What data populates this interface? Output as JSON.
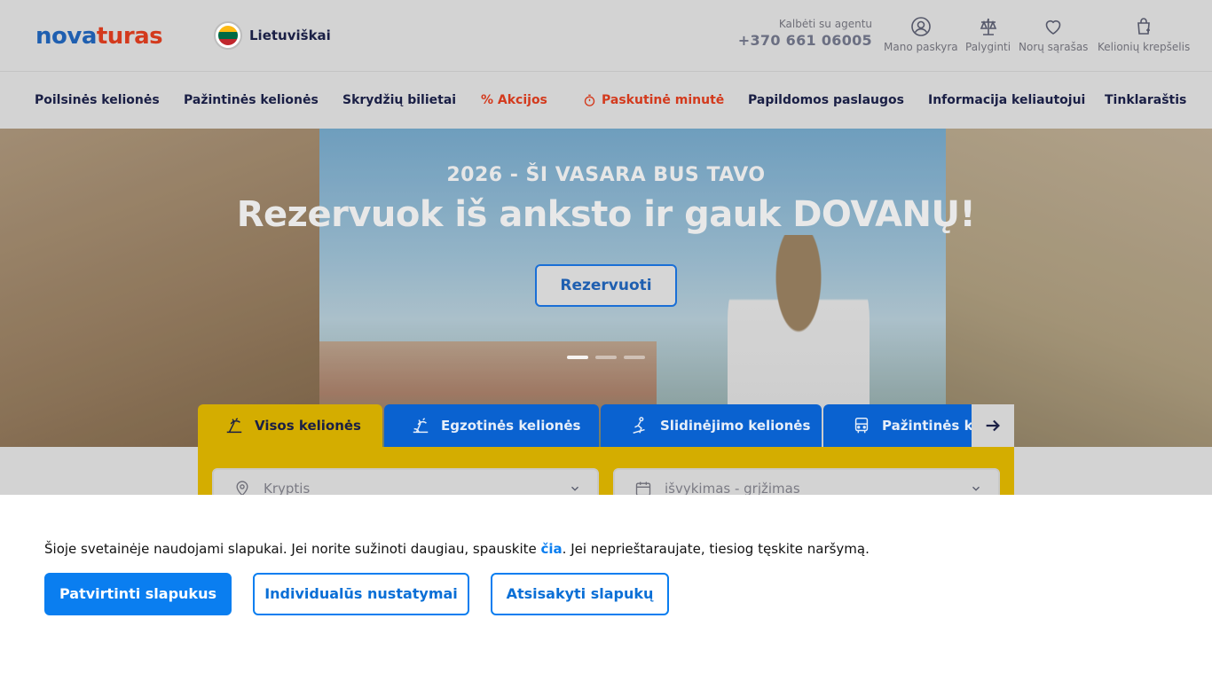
{
  "header": {
    "logo": {
      "part1": "nova",
      "part2": "turas"
    },
    "language": {
      "label": "Lietuviškai",
      "flag_colors": [
        "#fdb913",
        "#006a44",
        "#c1272d"
      ]
    },
    "agent": {
      "label": "Kalbėti su agentu",
      "phone": "+370 661 06005"
    },
    "icons": [
      {
        "name": "account-icon",
        "label": "Mano paskyra"
      },
      {
        "name": "compare-icon",
        "label": "Palyginti"
      },
      {
        "name": "wishlist-icon",
        "label": "Norų sąrašas"
      },
      {
        "name": "cart-icon",
        "label": "Kelionių krepšelis"
      }
    ]
  },
  "nav": {
    "items": [
      {
        "label": "Poilsinės kelionės"
      },
      {
        "label": "Pažintinės kelionės"
      },
      {
        "label": "Skrydžių bilietai"
      },
      {
        "label": "% Akcijos"
      },
      {
        "label": "Paskutinė minutė"
      },
      {
        "label": "Papildomos paslaugos"
      },
      {
        "label": "Informacija keliautojui"
      },
      {
        "label": "Tinklaraštis"
      }
    ]
  },
  "hero": {
    "kicker": "2026 - ŠI VASARA BUS TAVO",
    "title": "Rezervuok iš anksto ir gauk DOVANŲ!",
    "button": "Rezervuoti",
    "slides_count": 3,
    "active_slide": 1
  },
  "search": {
    "tabs": [
      {
        "label": "Visos kelionės",
        "icon": "beach-icon"
      },
      {
        "label": "Egzotinės kelionės",
        "icon": "palm-icon"
      },
      {
        "label": "Slidinėjimo kelionės",
        "icon": "ski-icon"
      },
      {
        "label": "Pažintinės kelionės",
        "icon": "bus-icon"
      }
    ],
    "destination_placeholder": "Kryptis",
    "dates_placeholder": "išvykimas - grįžimas"
  },
  "cookies": {
    "text_before": "Šioje svetainėje naudojami slapukai. Jei norite sužinoti daugiau, spauskite ",
    "link": "čia",
    "text_after": ". Jei neprieštaraujate, tiesiog tęskite naršymą.",
    "accept": "Patvirtinti slapukus",
    "settings": "Individualūs nustatymai",
    "reject": "Atsisakyti slapukų"
  },
  "colors": {
    "brand_blue": "#1f5fb0",
    "brand_red": "#d33a1d",
    "search_yellow": "#d4ad00",
    "cookie_blue": "#0a7ef0"
  }
}
